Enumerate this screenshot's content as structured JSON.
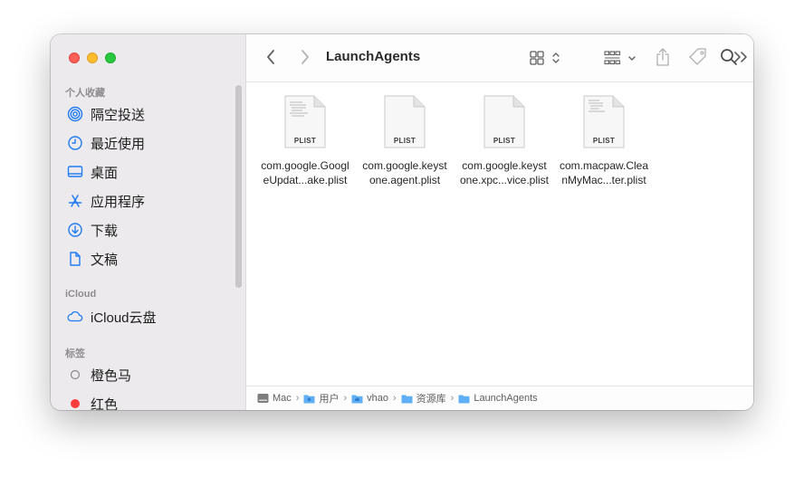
{
  "window": {
    "title": "LaunchAgents"
  },
  "sidebar": {
    "favorites_title": "个人收藏",
    "favorites": [
      {
        "label": "隔空投送",
        "icon": "airdrop-icon"
      },
      {
        "label": "最近使用",
        "icon": "clock-icon"
      },
      {
        "label": "桌面",
        "icon": "desktop-icon"
      },
      {
        "label": "应用程序",
        "icon": "applications-icon"
      },
      {
        "label": "下载",
        "icon": "download-icon"
      },
      {
        "label": "文稿",
        "icon": "document-icon"
      }
    ],
    "icloud_title": "iCloud",
    "icloud": [
      {
        "label": "iCloud云盘",
        "icon": "cloud-icon"
      }
    ],
    "tags_title": "标签",
    "tags": [
      {
        "label": "橙色马",
        "icon": "tag-empty-circle-icon",
        "color": "#8a8a8a"
      },
      {
        "label": "红色",
        "icon": "tag-red-circle-icon",
        "color": "#fc3b3b"
      }
    ]
  },
  "files": [
    {
      "line1": "com.google.Googl",
      "line2": "eUpdat...ake.plist",
      "badge": "PLIST"
    },
    {
      "line1": "com.google.keyst",
      "line2": "one.agent.plist",
      "badge": "PLIST"
    },
    {
      "line1": "com.google.keyst",
      "line2": "one.xpc...vice.plist",
      "badge": "PLIST"
    },
    {
      "line1": "com.macpaw.Clea",
      "line2": "nMyMac...ter.plist",
      "badge": "PLIST"
    }
  ],
  "pathbar": [
    "Mac",
    "用户",
    "vhao",
    "资源库",
    "LaunchAgents"
  ],
  "colors": {
    "accent": "#1f7cf5",
    "folder": "#5eaff5"
  }
}
